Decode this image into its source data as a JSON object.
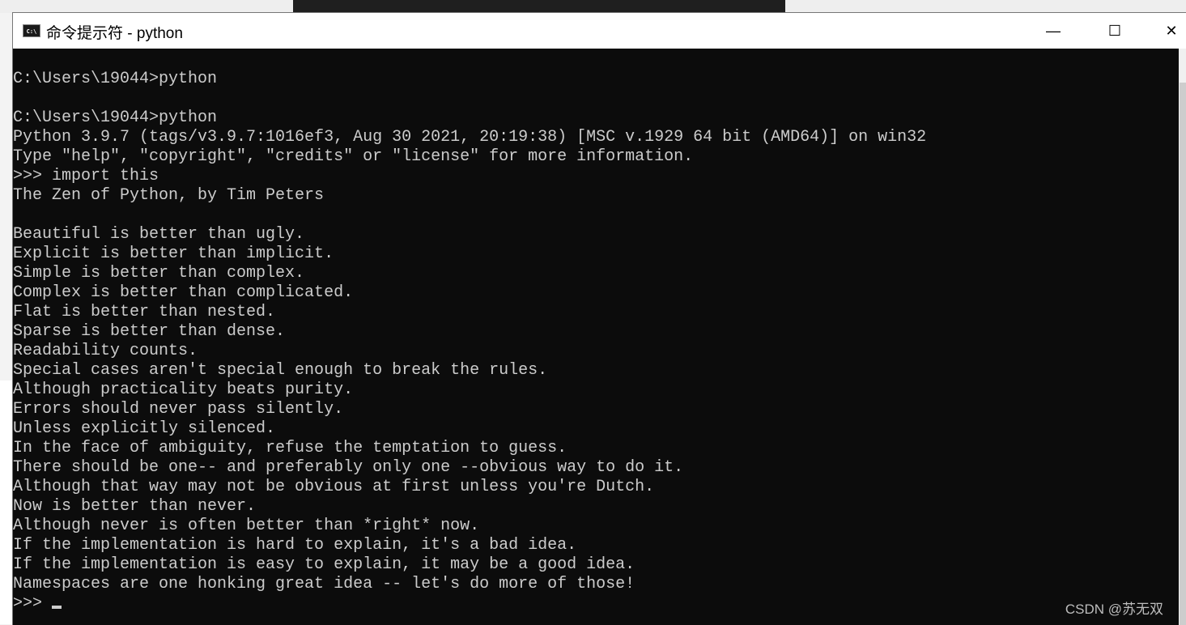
{
  "window": {
    "title": "命令提示符 - python",
    "icon": "cmd-icon",
    "controls": {
      "minimize": "—",
      "maximize": "☐",
      "close": "✕"
    }
  },
  "terminal": {
    "lines": [
      "C:\\Users\\19044>python",
      "",
      "C:\\Users\\19044>python",
      "Python 3.9.7 (tags/v3.9.7:1016ef3, Aug 30 2021, 20:19:38) [MSC v.1929 64 bit (AMD64)] on win32",
      "Type \"help\", \"copyright\", \"credits\" or \"license\" for more information.",
      ">>> import this",
      "The Zen of Python, by Tim Peters",
      "",
      "Beautiful is better than ugly.",
      "Explicit is better than implicit.",
      "Simple is better than complex.",
      "Complex is better than complicated.",
      "Flat is better than nested.",
      "Sparse is better than dense.",
      "Readability counts.",
      "Special cases aren't special enough to break the rules.",
      "Although practicality beats purity.",
      "Errors should never pass silently.",
      "Unless explicitly silenced.",
      "In the face of ambiguity, refuse the temptation to guess.",
      "There should be one-- and preferably only one --obvious way to do it.",
      "Although that way may not be obvious at first unless you're Dutch.",
      "Now is better than never.",
      "Although never is often better than *right* now.",
      "If the implementation is hard to explain, it's a bad idea.",
      "If the implementation is easy to explain, it may be a good idea.",
      "Namespaces are one honking great idea -- let's do more of those!"
    ],
    "prompt": ">>>"
  },
  "watermark": "CSDN @苏无双"
}
